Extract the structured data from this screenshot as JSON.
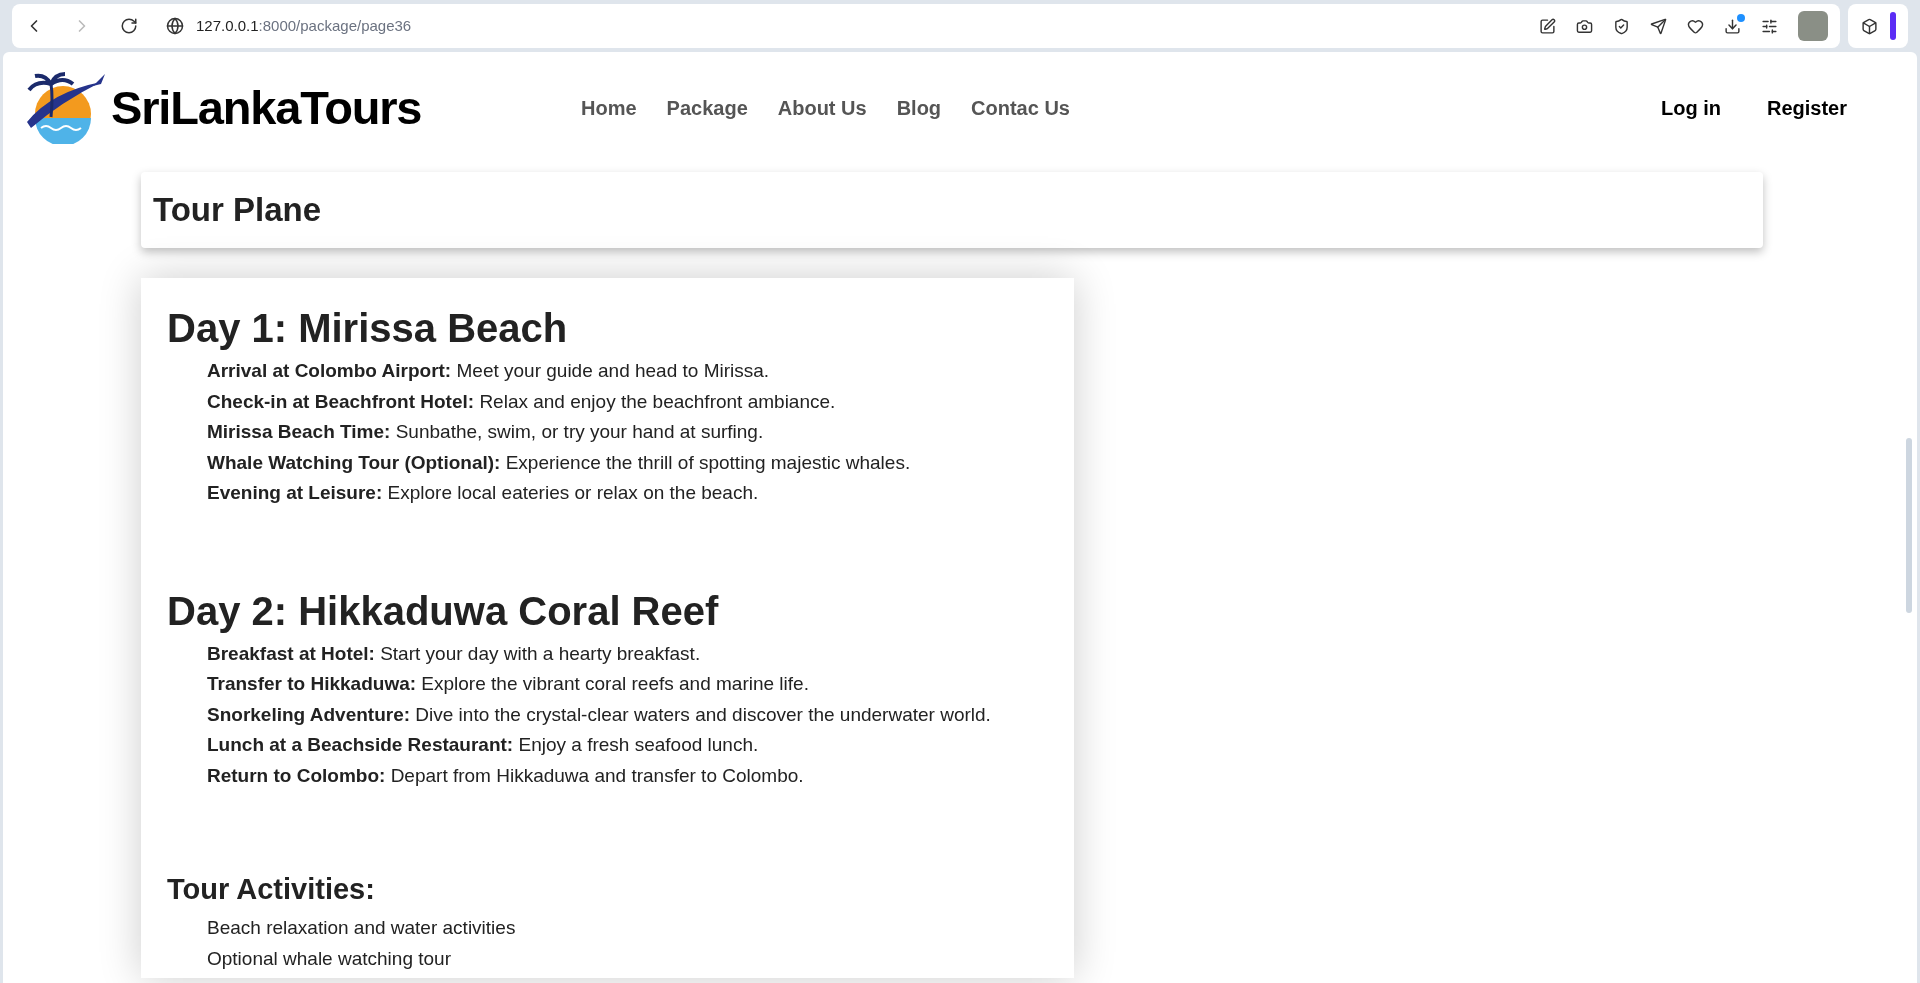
{
  "browser": {
    "url_host": "127.0.0.1",
    "url_path": ":8000/package/page36"
  },
  "site": {
    "logo_text": "SriLankaTours",
    "nav": [
      {
        "label": "Home"
      },
      {
        "label": "Package"
      },
      {
        "label": "About Us"
      },
      {
        "label": "Blog"
      },
      {
        "label": "Contac Us"
      }
    ],
    "auth": [
      {
        "label": "Log in"
      },
      {
        "label": "Register"
      }
    ]
  },
  "page_title": "Tour Plane",
  "sections": [
    {
      "kind": "day",
      "title": "Day 1: Mirissa Beach",
      "items": [
        {
          "term": "Arrival at Colombo Airport:",
          "text": "Meet your guide and head to Mirissa."
        },
        {
          "term": "Check-in at Beachfront Hotel:",
          "text": "Relax and enjoy the beachfront ambiance."
        },
        {
          "term": "Mirissa Beach Time:",
          "text": "Sunbathe, swim, or try your hand at surfing."
        },
        {
          "term": "Whale Watching Tour (Optional):",
          "text": "Experience the thrill of spotting majestic whales."
        },
        {
          "term": "Evening at Leisure:",
          "text": "Explore local eateries or relax on the beach."
        }
      ]
    },
    {
      "kind": "day",
      "title": "Day 2: Hikkaduwa Coral Reef",
      "items": [
        {
          "term": "Breakfast at Hotel:",
          "text": "Start your day with a hearty breakfast."
        },
        {
          "term": "Transfer to Hikkaduwa:",
          "text": "Explore the vibrant coral reefs and marine life."
        },
        {
          "term": "Snorkeling Adventure:",
          "text": "Dive into the crystal-clear waters and discover the underwater world."
        },
        {
          "term": "Lunch at a Beachside Restaurant:",
          "text": "Enjoy a fresh seafood lunch."
        },
        {
          "term": "Return to Colombo:",
          "text": "Depart from Hikkaduwa and transfer to Colombo."
        }
      ]
    },
    {
      "kind": "activities",
      "title": "Tour Activities:",
      "items": [
        {
          "text": "Beach relaxation and water activities"
        },
        {
          "text": "Optional whale watching tour"
        }
      ]
    }
  ]
}
